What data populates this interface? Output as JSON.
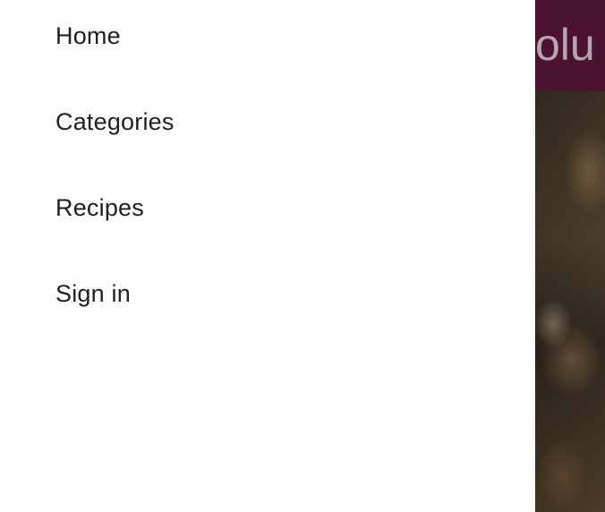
{
  "drawer": {
    "items": [
      {
        "label": "Home"
      },
      {
        "label": "Categories"
      },
      {
        "label": "Recipes"
      },
      {
        "label": "Sign in"
      }
    ]
  },
  "page": {
    "header_title_visible": "olu",
    "header_color": "#4c1231",
    "hero_image": "food-photo"
  }
}
